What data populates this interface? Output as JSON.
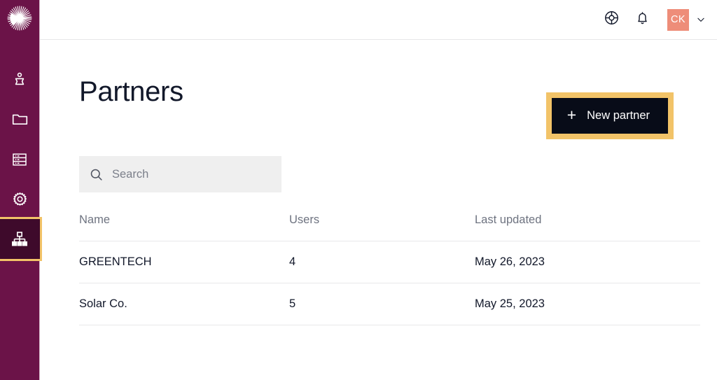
{
  "sidebar": {
    "logo": {
      "icon": "starburst-logo-icon",
      "label": "Starburst"
    },
    "items": [
      {
        "icon": "user-icon",
        "label": "Users",
        "selected": false
      },
      {
        "icon": "folder-icon",
        "label": "Catalogs",
        "selected": false
      },
      {
        "icon": "database-icon",
        "label": "Data",
        "selected": false
      },
      {
        "icon": "gear-icon",
        "label": "Settings",
        "selected": false
      },
      {
        "icon": "org-chart-icon",
        "label": "Partners",
        "selected": true
      }
    ]
  },
  "topbar": {
    "help_icon": "lifebuoy-icon",
    "notifications_icon": "bell-icon",
    "avatar_initials": "CK",
    "chevron_icon": "chevron-down-icon"
  },
  "main": {
    "title": "Partners",
    "new_button": {
      "label": "New partner",
      "icon": "plus-icon"
    },
    "search": {
      "value": "",
      "placeholder": "Search",
      "icon": "search-icon"
    },
    "table": {
      "columns": [
        "Name",
        "Users",
        "Last updated"
      ],
      "rows": [
        {
          "name": "GREENTECH",
          "users": "4",
          "updated": "May 26, 2023"
        },
        {
          "name": "Solar Co.",
          "users": "5",
          "updated": "May 25, 2023"
        }
      ]
    }
  },
  "colors": {
    "sidebar_purple": "#6B1348",
    "sidebar_selected_bg": "#3E0A2B",
    "focus_gold": "#F2C368",
    "button_dark": "#080C18",
    "avatar_salmon": "#EE8D79",
    "text_dark": "#12182A",
    "text_muted": "#6E7380",
    "search_bg": "#EFEFEF",
    "divider": "#E8E8EA"
  }
}
